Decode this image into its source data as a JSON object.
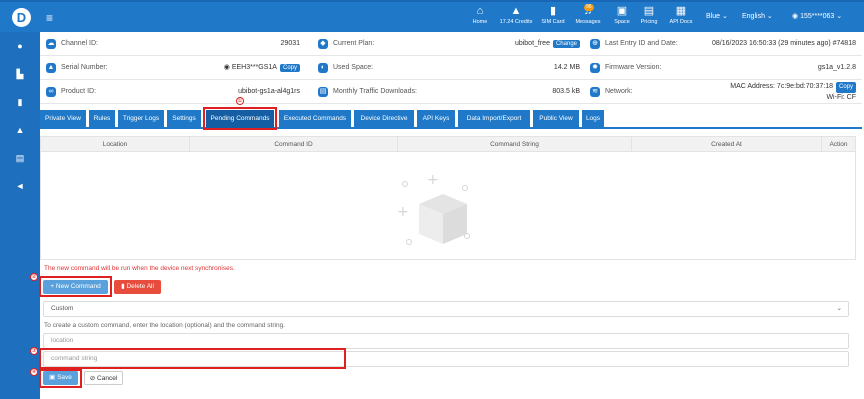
{
  "topbar": {
    "logo": "D",
    "menu_icon": "menu-icon",
    "nav": [
      {
        "label": "Home",
        "icon": "home-icon",
        "glyph": "⌂"
      },
      {
        "label": "17.24 Credits",
        "icon": "credits-icon",
        "glyph": "▲"
      },
      {
        "label": "SIM Card",
        "icon": "sim-icon",
        "glyph": "▮"
      },
      {
        "label": "Messages",
        "icon": "bell-icon",
        "glyph": "♫",
        "badge": "96"
      },
      {
        "label": "Space",
        "icon": "space-icon",
        "glyph": "▣"
      },
      {
        "label": "Pricing",
        "icon": "pricing-icon",
        "glyph": "▤"
      },
      {
        "label": "API Docs",
        "icon": "docs-icon",
        "glyph": "▦"
      }
    ],
    "theme": "Blue",
    "language": "English",
    "user": "155****063"
  },
  "sidebar_icons": [
    "home-icon",
    "chart-icon",
    "bookmark-icon",
    "user-icon",
    "list-icon",
    "megaphone-icon"
  ],
  "info": {
    "channel_id_label": "Channel ID:",
    "channel_id": "29031",
    "current_plan_label": "Current Plan:",
    "current_plan": "ubibot_free",
    "change_label": "Change",
    "last_entry_label": "Last Entry ID and Date:",
    "last_entry": "08/16/2023 16:50:33 (29 minutes ago) #74818",
    "serial_label": "Serial Number:",
    "serial": "EEH3***GS1A",
    "copy_label": "Copy",
    "used_space_label": "Used Space:",
    "used_space": "14.2 MB",
    "firmware_label": "Firmware Version:",
    "firmware": "gs1a_v1.2.8",
    "product_label": "Product ID:",
    "product": "ubibot-gs1a-al4g1rs",
    "traffic_label": "Monthly Traffic Downloads:",
    "traffic": "803.5 kB",
    "network_label": "Network:",
    "mac": "MAC Address: 7c:9e:bd:70:37:18",
    "wifi": "Wi-Fi: CF"
  },
  "tabs": [
    "Private View",
    "Rules",
    "Trigger Logs",
    "Settings",
    "Pending Commands",
    "Executed Commands",
    "Device Directive",
    "API Keys",
    "Data Import/Export",
    "Public View",
    "Logs"
  ],
  "active_tab": "Pending Commands",
  "table": {
    "columns": [
      "Location",
      "Command ID",
      "Command String",
      "Created At",
      "Action"
    ]
  },
  "notice": "The new command will be run when the device next synchronises.",
  "buttons": {
    "new_command": "+ New Command",
    "delete_all": "Delete All",
    "save": "Save",
    "cancel": "Cancel"
  },
  "form": {
    "type_value": "Custom",
    "hint": "To create a custom command, enter the location (optional) and the command string.",
    "location_placeholder": "location",
    "command_placeholder": "command string"
  },
  "markers": [
    "①",
    "②",
    "③",
    "④"
  ],
  "colors": {
    "primary": "#1f78c8",
    "danger": "#e74c3c",
    "highlight": "#e02020"
  }
}
